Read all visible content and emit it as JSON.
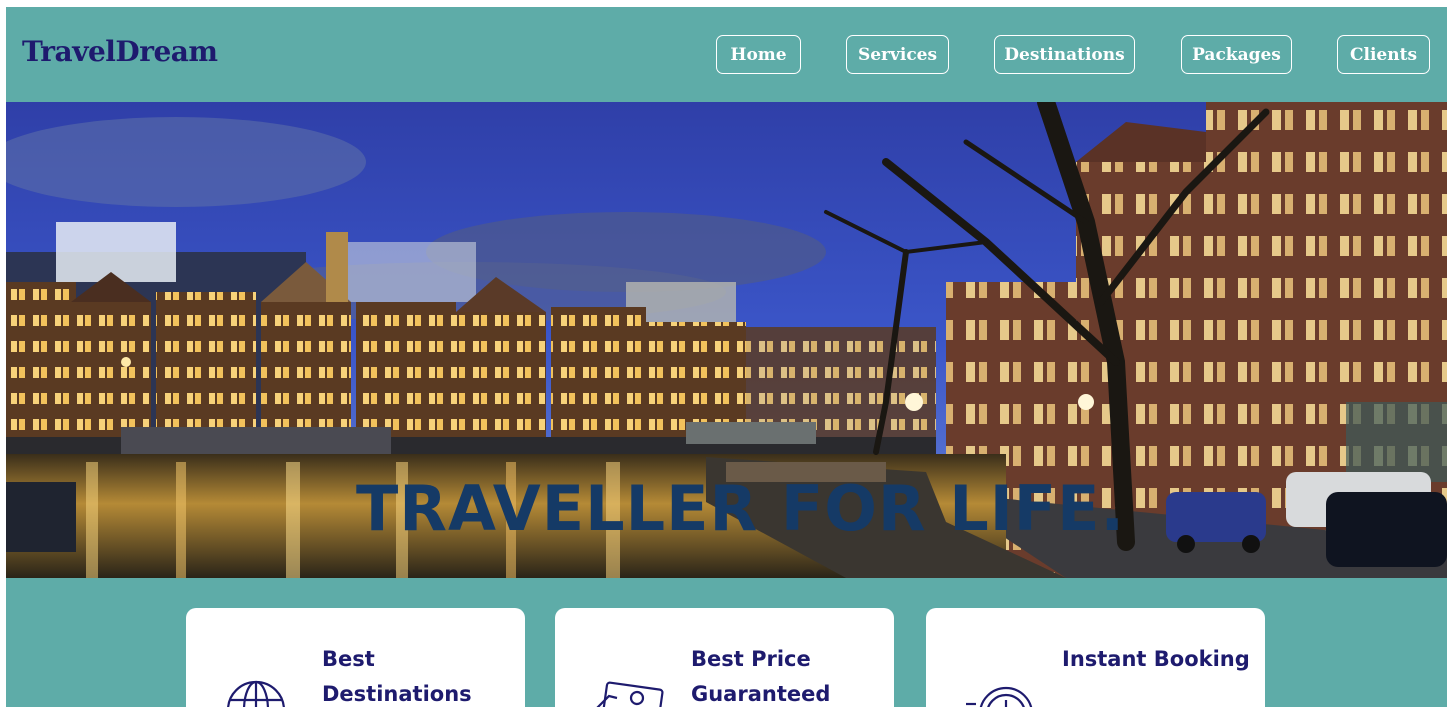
{
  "brand": "TravelDream",
  "nav": {
    "home": "Home",
    "services": "Services",
    "destinations": "Destinations",
    "packages": "Packages",
    "clients": "Clients"
  },
  "hero": {
    "tagline": "TRAVELLER FOR LIFE."
  },
  "features": [
    {
      "title": "Best Destinations",
      "icon": "globe-icon"
    },
    {
      "title": "Best Price Guaranteed",
      "icon": "money-icon"
    },
    {
      "title": "Instant Booking",
      "icon": "clock-icon"
    }
  ],
  "colors": {
    "background": "#5eaca8",
    "brand": "#1e1b6e",
    "tagline": "#153a66",
    "card": "#ffffff"
  }
}
